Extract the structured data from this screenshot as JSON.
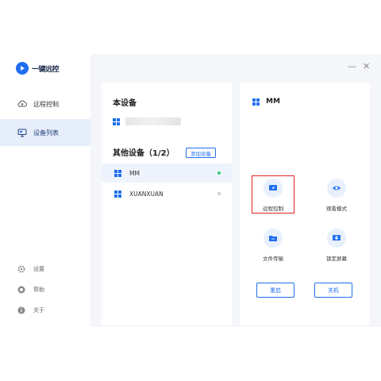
{
  "app": {
    "logo_text": "一键远控"
  },
  "window_controls": {
    "minimize": "—",
    "close": "✕"
  },
  "sidebar": {
    "items": [
      {
        "label": "远程控制",
        "icon": "cloud-upload-icon",
        "active": false
      },
      {
        "label": "设备列表",
        "icon": "device-list-icon",
        "active": true
      }
    ],
    "bottom_items": [
      {
        "label": "设置",
        "icon": "gear-icon"
      },
      {
        "label": "帮助",
        "icon": "help-icon"
      },
      {
        "label": "关于",
        "icon": "info-icon"
      }
    ]
  },
  "this_device": {
    "title": "本设备"
  },
  "other_devices": {
    "title": "其他设备（1/2）",
    "add_button": "添加设备",
    "devices": [
      {
        "name": "MM",
        "online": true
      },
      {
        "name": "XUANXUAN",
        "online": false
      }
    ]
  },
  "detail": {
    "device_name": "MM",
    "actions": [
      {
        "label": "远程控制",
        "icon": "remote-control-icon"
      },
      {
        "label": "观看模式",
        "icon": "eye-icon"
      },
      {
        "label": "文件传输",
        "icon": "folder-icon"
      },
      {
        "label": "锁定屏幕",
        "icon": "lock-screen-icon"
      }
    ],
    "buttons": {
      "restart": "重启",
      "shutdown": "关机"
    }
  },
  "colors": {
    "accent": "#1f6ff0",
    "online": "#2ecc71",
    "offline": "#cccccc",
    "highlight": "#e02020"
  }
}
